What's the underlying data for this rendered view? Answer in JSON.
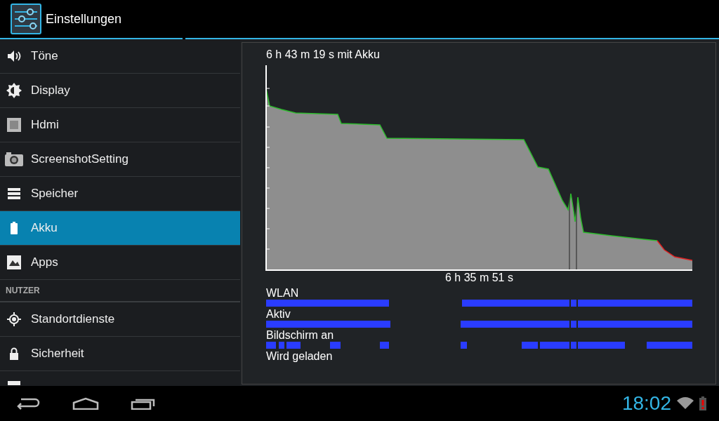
{
  "app_bar": {
    "title": "Einstellungen"
  },
  "sidebar": {
    "items": [
      {
        "kind": "sound",
        "label": "Töne",
        "selected": false
      },
      {
        "kind": "display",
        "label": "Display",
        "selected": false
      },
      {
        "kind": "hdmi",
        "label": "Hdmi",
        "selected": false
      },
      {
        "kind": "camera",
        "label": "ScreenshotSetting",
        "selected": false
      },
      {
        "kind": "storage",
        "label": "Speicher",
        "selected": false
      },
      {
        "kind": "battery",
        "label": "Akku",
        "selected": true
      },
      {
        "kind": "apps",
        "label": "Apps",
        "selected": false
      },
      {
        "kind": "header",
        "label": "NUTZER"
      },
      {
        "kind": "location",
        "label": "Standortdienste",
        "selected": false
      },
      {
        "kind": "lock",
        "label": "Sicherheit",
        "selected": false
      },
      {
        "kind": "partial",
        "selected": false
      }
    ]
  },
  "battery_panel": {
    "duration": "6 h 43 m 19 s mit Akku",
    "graph_span": "6 h 35 m 51 s",
    "activity_rows": [
      {
        "label": "WLAN"
      },
      {
        "label": "Aktiv"
      },
      {
        "label": "Bildschirm an"
      },
      {
        "label": "Wird geladen"
      }
    ]
  },
  "status_bar": {
    "time": "18:02"
  }
}
